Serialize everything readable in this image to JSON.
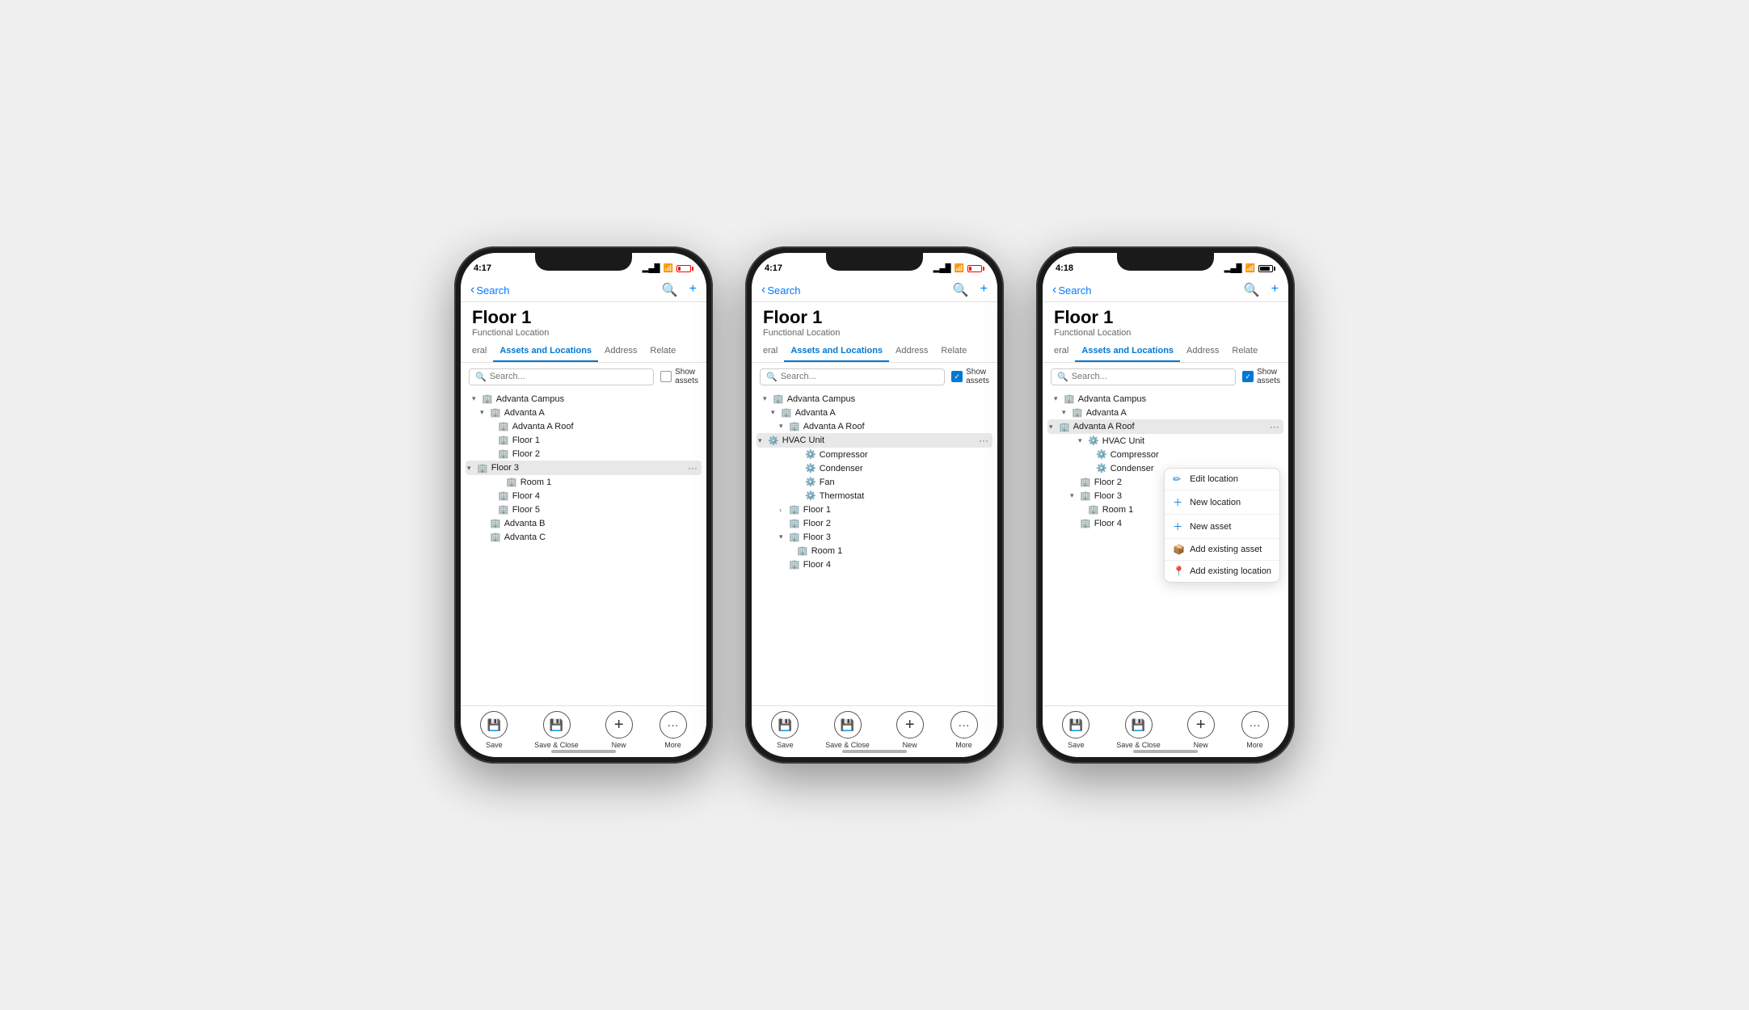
{
  "phones": [
    {
      "id": "phone1",
      "status_time": "4:17",
      "back_label": "Search",
      "page_title": "Floor 1",
      "page_subtitle": "Functional Location",
      "tabs": [
        "eral",
        "Assets and Locations",
        "Address",
        "Relate"
      ],
      "active_tab": "Assets and Locations",
      "search_placeholder": "Search...",
      "show_assets_checked": false,
      "show_assets_label": "Show\nassets",
      "tree": [
        {
          "level": 1,
          "type": "location",
          "expand": true,
          "label": "Advanta Campus"
        },
        {
          "level": 2,
          "type": "location",
          "expand": true,
          "label": "Advanta A"
        },
        {
          "level": 3,
          "type": "location",
          "expand": false,
          "label": "Advanta A Roof"
        },
        {
          "level": 3,
          "type": "location",
          "expand": false,
          "label": "Floor 1"
        },
        {
          "level": 3,
          "type": "location",
          "expand": false,
          "label": "Floor 2"
        },
        {
          "level": 3,
          "type": "location",
          "expand": true,
          "label": "Floor 3",
          "highlighted": true,
          "ellipsis": true
        },
        {
          "level": 4,
          "type": "location",
          "expand": false,
          "label": "Room 1"
        },
        {
          "level": 3,
          "type": "location",
          "expand": false,
          "label": "Floor 4"
        },
        {
          "level": 3,
          "type": "location",
          "expand": false,
          "label": "Floor 5"
        },
        {
          "level": 2,
          "type": "location",
          "expand": false,
          "label": "Advanta B"
        },
        {
          "level": 2,
          "type": "location",
          "expand": false,
          "label": "Advanta C"
        }
      ],
      "toolbar": [
        {
          "label": "Save",
          "icon": "💾"
        },
        {
          "label": "Save & Close",
          "icon": "💾"
        },
        {
          "label": "New",
          "icon": "+"
        },
        {
          "label": "More",
          "icon": "···"
        }
      ]
    },
    {
      "id": "phone2",
      "status_time": "4:17",
      "back_label": "Search",
      "page_title": "Floor 1",
      "page_subtitle": "Functional Location",
      "tabs": [
        "eral",
        "Assets and Locations",
        "Address",
        "Relate"
      ],
      "active_tab": "Assets and Locations",
      "search_placeholder": "Search...",
      "show_assets_checked": true,
      "show_assets_label": "Show\nassets",
      "tree": [
        {
          "level": 1,
          "type": "location",
          "expand": true,
          "label": "Advanta Campus"
        },
        {
          "level": 2,
          "type": "location",
          "expand": true,
          "label": "Advanta A"
        },
        {
          "level": 3,
          "type": "location",
          "expand": true,
          "label": "Advanta A Roof"
        },
        {
          "level": 4,
          "type": "asset",
          "expand": true,
          "label": "HVAC Unit",
          "highlighted": true,
          "ellipsis": true
        },
        {
          "level": 5,
          "type": "asset",
          "expand": false,
          "label": "Compressor"
        },
        {
          "level": 5,
          "type": "asset",
          "expand": false,
          "label": "Condenser"
        },
        {
          "level": 5,
          "type": "asset",
          "expand": false,
          "label": "Fan"
        },
        {
          "level": 5,
          "type": "asset",
          "expand": false,
          "label": "Thermostat"
        },
        {
          "level": 3,
          "type": "location",
          "expand": false,
          "label": "Floor 1"
        },
        {
          "level": 3,
          "type": "location",
          "expand": false,
          "label": "Floor 2"
        },
        {
          "level": 3,
          "type": "location",
          "expand": true,
          "label": "Floor 3"
        },
        {
          "level": 4,
          "type": "location",
          "expand": false,
          "label": "Room 1"
        },
        {
          "level": 3,
          "type": "location",
          "expand": false,
          "label": "Floor 4"
        }
      ],
      "toolbar": [
        {
          "label": "Save",
          "icon": "💾"
        },
        {
          "label": "Save & Close",
          "icon": "💾"
        },
        {
          "label": "New",
          "icon": "+"
        },
        {
          "label": "More",
          "icon": "···"
        }
      ]
    },
    {
      "id": "phone3",
      "status_time": "4:18",
      "back_label": "Search",
      "page_title": "Floor 1",
      "page_subtitle": "Functional Location",
      "tabs": [
        "eral",
        "Assets and Locations",
        "Address",
        "Relate"
      ],
      "active_tab": "Assets and Locations",
      "search_placeholder": "Search...",
      "show_assets_checked": true,
      "show_assets_label": "Show\nassets",
      "tree": [
        {
          "level": 1,
          "type": "location",
          "expand": true,
          "label": "Advanta Campus"
        },
        {
          "level": 2,
          "type": "location",
          "expand": true,
          "label": "Advanta A"
        },
        {
          "level": 3,
          "type": "location",
          "expand": true,
          "label": "Advanta A Roof",
          "highlighted": true,
          "ellipsis": true
        },
        {
          "level": 4,
          "type": "asset",
          "expand": true,
          "label": "H..."
        },
        {
          "level": 4,
          "type": "asset",
          "expand": false,
          "label": "C..."
        },
        {
          "level": 4,
          "type": "asset",
          "expand": false,
          "label": "C..."
        },
        {
          "level": 3,
          "type": "location",
          "expand": false,
          "label": "Floor 2"
        },
        {
          "level": 3,
          "type": "location",
          "expand": true,
          "label": "Floor 3"
        },
        {
          "level": 4,
          "type": "location",
          "expand": false,
          "label": "Room 1"
        },
        {
          "level": 3,
          "type": "location",
          "expand": false,
          "label": "Floor 4"
        }
      ],
      "context_menu": [
        {
          "icon": "✏️",
          "label": "Edit location"
        },
        {
          "icon": "➕",
          "label": "New location"
        },
        {
          "icon": "➕",
          "label": "New asset"
        },
        {
          "icon": "📦",
          "label": "Add existing asset"
        },
        {
          "icon": "📍",
          "label": "Add existing location"
        }
      ],
      "toolbar": [
        {
          "label": "Save",
          "icon": "💾"
        },
        {
          "label": "Save & Close",
          "icon": "💾"
        },
        {
          "label": "New",
          "icon": "+"
        },
        {
          "label": "More",
          "icon": "···"
        }
      ]
    }
  ]
}
